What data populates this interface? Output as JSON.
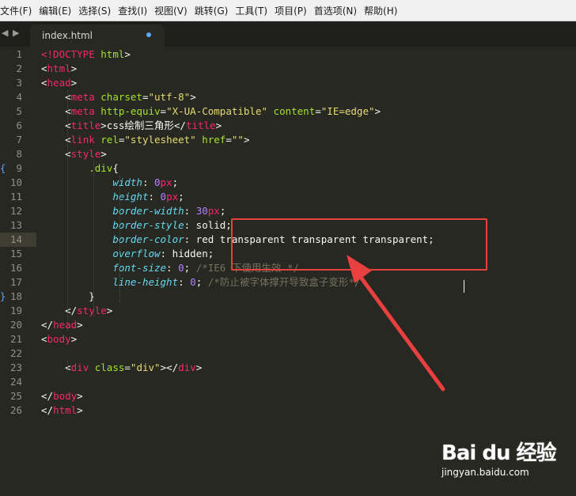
{
  "menu": [
    "文件(F)",
    "编辑(E)",
    "选择(S)",
    "查找(I)",
    "视图(V)",
    "跳转(G)",
    "工具(T)",
    "项目(P)",
    "首选项(N)",
    "帮助(H)"
  ],
  "tab": {
    "nav": "◀ ▶",
    "filename": "index.html"
  },
  "lines": [
    [
      [
        "t",
        "&lt;"
      ],
      [
        "t",
        "!DOCTYPE"
      ],
      [
        "w",
        " "
      ],
      [
        "a",
        "html"
      ],
      [
        "w",
        "&gt;"
      ]
    ],
    [
      [
        "w",
        "&lt;"
      ],
      [
        "t",
        "html"
      ],
      [
        "w",
        "&gt;"
      ]
    ],
    [
      [
        "w",
        "&lt;"
      ],
      [
        "t",
        "head"
      ],
      [
        "w",
        "&gt;"
      ]
    ],
    [
      [
        "w",
        "    &lt;"
      ],
      [
        "t",
        "meta"
      ],
      [
        "w",
        " "
      ],
      [
        "a",
        "charset"
      ],
      [
        "w",
        "="
      ],
      [
        "s",
        "\"utf-8\""
      ],
      [
        "w",
        "&gt;"
      ]
    ],
    [
      [
        "w",
        "    &lt;"
      ],
      [
        "t",
        "meta"
      ],
      [
        "w",
        " "
      ],
      [
        "a",
        "http-equiv"
      ],
      [
        "w",
        "="
      ],
      [
        "s",
        "\"X-UA-Compatible\""
      ],
      [
        "w",
        " "
      ],
      [
        "a",
        "content"
      ],
      [
        "w",
        "="
      ],
      [
        "s",
        "\"IE=edge\""
      ],
      [
        "w",
        "&gt;"
      ]
    ],
    [
      [
        "w",
        "    &lt;"
      ],
      [
        "t",
        "title"
      ],
      [
        "w",
        "&gt;css绘制三角形&lt;/"
      ],
      [
        "t",
        "title"
      ],
      [
        "w",
        "&gt;"
      ]
    ],
    [
      [
        "w",
        "    &lt;"
      ],
      [
        "t",
        "link"
      ],
      [
        "w",
        " "
      ],
      [
        "a",
        "rel"
      ],
      [
        "w",
        "="
      ],
      [
        "s",
        "\"stylesheet\""
      ],
      [
        "w",
        " "
      ],
      [
        "a",
        "href"
      ],
      [
        "w",
        "="
      ],
      [
        "s",
        "\"\""
      ],
      [
        "w",
        "&gt;"
      ]
    ],
    [
      [
        "w",
        "    &lt;"
      ],
      [
        "t",
        "style"
      ],
      [
        "w",
        "&gt;"
      ]
    ],
    [
      [
        "w",
        "        "
      ],
      [
        "a",
        ".div"
      ],
      [
        "w",
        "{"
      ]
    ],
    [
      [
        "w",
        "            "
      ],
      [
        "p",
        "width"
      ],
      [
        "w",
        ": "
      ],
      [
        "n",
        "0"
      ],
      [
        "k",
        "px"
      ],
      [
        "w",
        ";"
      ]
    ],
    [
      [
        "w",
        "            "
      ],
      [
        "p",
        "height"
      ],
      [
        "w",
        ": "
      ],
      [
        "n",
        "0"
      ],
      [
        "k",
        "px"
      ],
      [
        "w",
        ";"
      ]
    ],
    [
      [
        "w",
        "            "
      ],
      [
        "p",
        "border-width"
      ],
      [
        "w",
        ": "
      ],
      [
        "n",
        "30"
      ],
      [
        "k",
        "px"
      ],
      [
        "w",
        ";"
      ]
    ],
    [
      [
        "w",
        "            "
      ],
      [
        "p",
        "border-style"
      ],
      [
        "w",
        ": solid;"
      ]
    ],
    [
      [
        "w",
        "            "
      ],
      [
        "p",
        "border-color"
      ],
      [
        "w",
        ": red transparent transparent transparent;"
      ]
    ],
    [
      [
        "w",
        "            "
      ],
      [
        "p",
        "overflow"
      ],
      [
        "w",
        ": hidden;"
      ]
    ],
    [
      [
        "w",
        "            "
      ],
      [
        "p",
        "font-size"
      ],
      [
        "w",
        ": "
      ],
      [
        "n",
        "0"
      ],
      [
        "w",
        "; "
      ],
      [
        "c",
        "/*IE6 下使用生效 */"
      ]
    ],
    [
      [
        "w",
        "            "
      ],
      [
        "p",
        "line-height"
      ],
      [
        "w",
        ": "
      ],
      [
        "n",
        "0"
      ],
      [
        "w",
        "; "
      ],
      [
        "c",
        "/*防止被字体撑开导致盒子变形*/"
      ]
    ],
    [
      [
        "w",
        "        }"
      ]
    ],
    [
      [
        "w",
        "    &lt;/"
      ],
      [
        "t",
        "style"
      ],
      [
        "w",
        "&gt;"
      ]
    ],
    [
      [
        "w",
        "&lt;/"
      ],
      [
        "t",
        "head"
      ],
      [
        "w",
        "&gt;"
      ]
    ],
    [
      [
        "w",
        "&lt;"
      ],
      [
        "t",
        "body"
      ],
      [
        "w",
        "&gt;"
      ]
    ],
    [
      [
        "w",
        ""
      ]
    ],
    [
      [
        "w",
        "    &lt;"
      ],
      [
        "t",
        "div"
      ],
      [
        "w",
        " "
      ],
      [
        "a",
        "class"
      ],
      [
        "w",
        "="
      ],
      [
        "s",
        "\"div\""
      ],
      [
        "w",
        "&gt;&lt;/"
      ],
      [
        "t",
        "div"
      ],
      [
        "w",
        "&gt;"
      ]
    ],
    [
      [
        "w",
        ""
      ]
    ],
    [
      [
        "w",
        "&lt;/"
      ],
      [
        "t",
        "body"
      ],
      [
        "w",
        "&gt;"
      ]
    ],
    [
      [
        "w",
        "&lt;/"
      ],
      [
        "t",
        "html"
      ],
      [
        "w",
        "&gt;"
      ]
    ]
  ],
  "current_line": 14,
  "fold_markers": [
    {
      "line": 9,
      "glyph": "{"
    },
    {
      "line": 18,
      "glyph": "}"
    }
  ],
  "watermark": {
    "logo": "Bai du 经验",
    "url": "jingyan.baidu.com"
  },
  "colors": {
    "background": "#272822",
    "annotation": "#e8403f",
    "tag": "#f92672",
    "attr": "#a6e22e",
    "string": "#e6db74",
    "property": "#66d9ef",
    "number": "#ae81ff",
    "comment": "#75715e"
  }
}
